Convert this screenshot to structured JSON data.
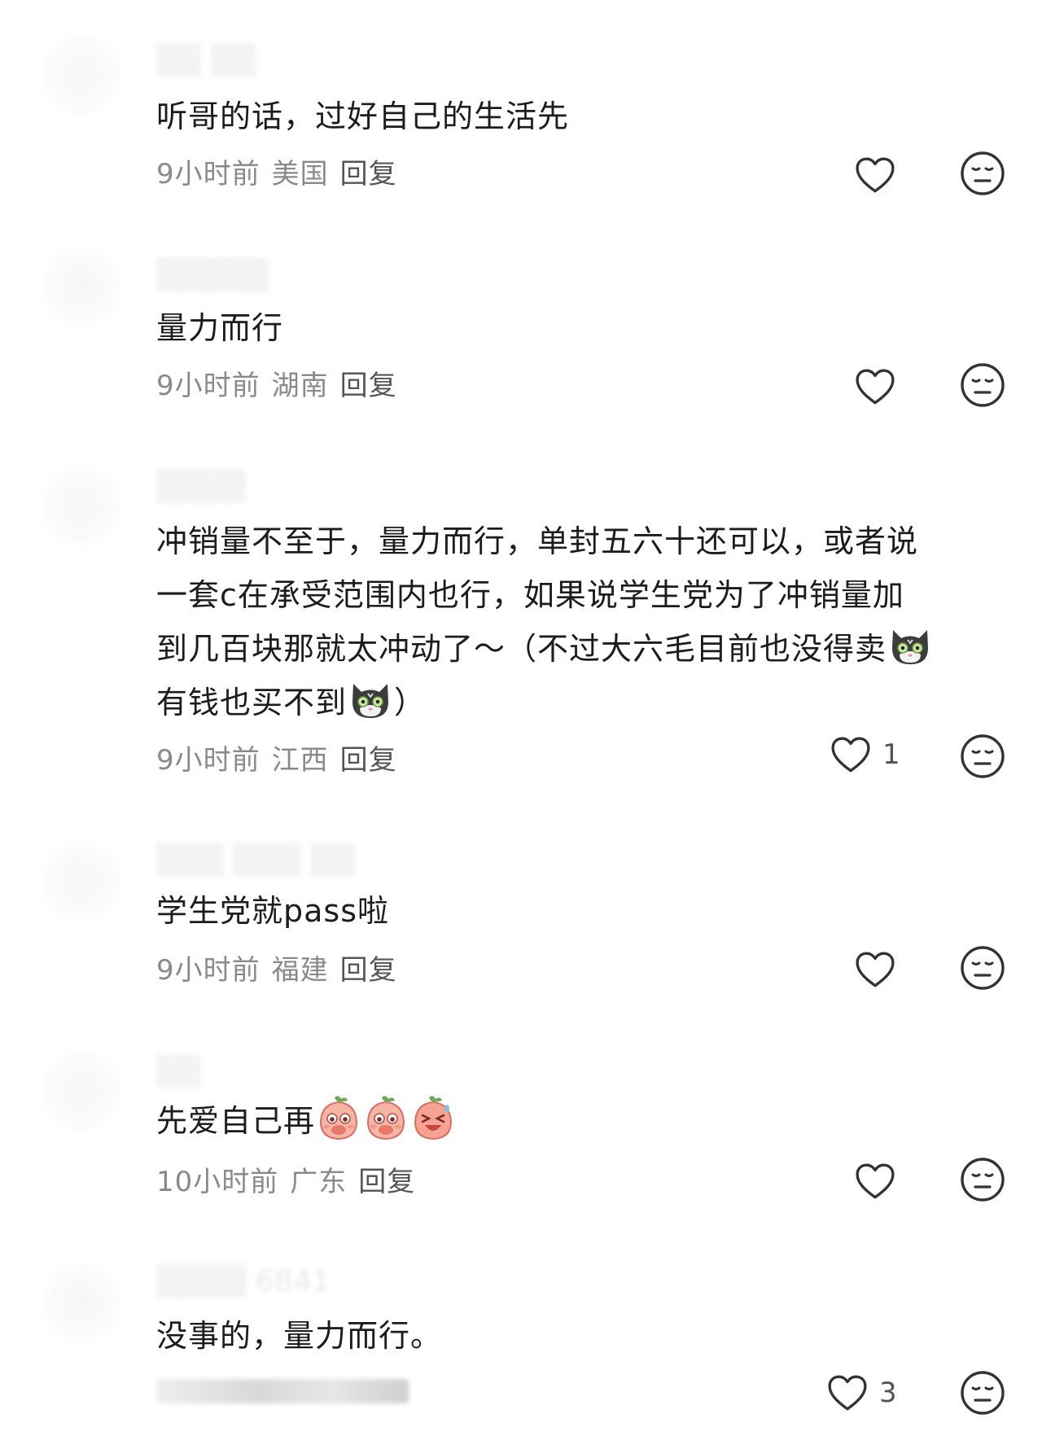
{
  "comments": [
    {
      "text": "听哥的话，过好自己的生活先",
      "time": "9小时前",
      "location": "美国",
      "reply": "回复",
      "likes": ""
    },
    {
      "text": "量力而行",
      "time": "9小时前",
      "location": "湖南",
      "reply": "回复",
      "likes": ""
    },
    {
      "text_lines": [
        "冲销量不至于，量力而行，单封五六十还可以，或者说",
        "一套c在承受范围内也行，如果说学生党为了冲销量加",
        "到几百块那就太冲动了～（不过大六毛目前也没得卖",
        "有钱也买不到"
      ],
      "text_tail": "）",
      "time": "9小时前",
      "location": "江西",
      "reply": "回复",
      "likes": "1"
    },
    {
      "text": "学生党就pass啦",
      "time": "9小时前",
      "location": "福建",
      "reply": "回复",
      "likes": ""
    },
    {
      "text": "先爱自己再",
      "time": "10小时前",
      "location": "广东",
      "reply": "回复",
      "likes": ""
    },
    {
      "text": "没事的，量力而行。",
      "likes": "3"
    }
  ],
  "icons": {
    "like": "heart-outline-icon",
    "dislike": "meh-face-icon",
    "emoji_cat": "cat-face-emoji",
    "emoji_peach": "peach-face-emoji"
  },
  "colors": {
    "text": "#1c1c1c",
    "meta": "#8a8a8a",
    "icon": "#333333"
  }
}
